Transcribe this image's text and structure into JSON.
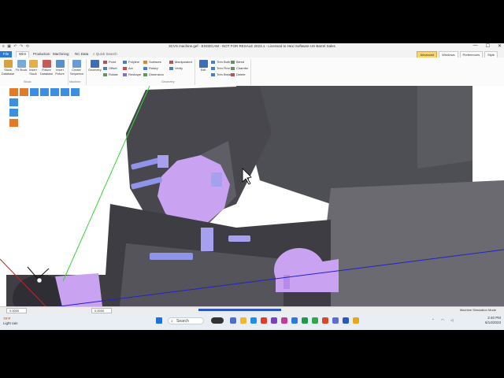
{
  "window": {
    "title": "3CVS machine.gef - ESGECAM - NOT FOR RESALE 2023.1 - Licensed to Hexi Software US Barrel Sales",
    "controls": [
      "—",
      "☐",
      "✕"
    ]
  },
  "quick_access": "≡ ▣ ↶ ↷ ⟲",
  "menu": {
    "tabs": [
      "File",
      "Wire",
      "Production",
      "Machining",
      "NC Data"
    ],
    "quick_search": "Quick Search",
    "right_tabs": [
      "Advanced",
      "Windows",
      "Preferences",
      "Style"
    ]
  },
  "ribbon": {
    "stock_buttons": [
      "Stock Database",
      "Fit Stock",
      "Insert Stock",
      "Fixture Database",
      "Insert Fixture"
    ],
    "machine_buttons": [
      "Create Sequence"
    ],
    "geometry_buttons": [
      "Geometry"
    ],
    "small_col1": [
      "Point",
      "Offset",
      "Rotate"
    ],
    "small_col2": [
      "Polyline",
      "Arc",
      "Reshape"
    ],
    "small_col3": [
      "Surfaces",
      "Rotary",
      "Dimension"
    ],
    "small_col4": [
      "Manipulated",
      "Verify"
    ],
    "edit_buttons": [
      "Edit"
    ],
    "small_col5": [
      "Trim Both",
      "Trim First",
      "Trim Break"
    ],
    "small_col6": [
      "Blend",
      "Chamfer",
      "Delete"
    ],
    "groups": [
      "Stock",
      "Machine",
      "Geometry"
    ]
  },
  "status": {
    "left_box": "0.0000",
    "mid_box": "0.0000",
    "right_text": "Machine Simulation Mode"
  },
  "taskbar": {
    "temp": "79°F",
    "weather": "Light rain",
    "search": "Search",
    "time": "2:40 PM",
    "date": "6/14/2023"
  },
  "colors": {
    "accent": "#2b7ad6",
    "turret": "#4e4f55",
    "turret_face": "#5f5e66",
    "purple_part": "#c9a2f2",
    "tool": "#8f93ea"
  }
}
